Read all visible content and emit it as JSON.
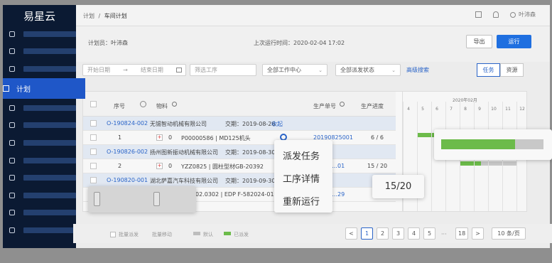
{
  "app": {
    "logo": "易星云"
  },
  "sidebar": {
    "active_label": "计划"
  },
  "header": {
    "crumb_parent": "计划",
    "crumb_sep": "/",
    "crumb_current": "车间计划",
    "user": "叶沛森"
  },
  "info": {
    "planner": "计划员：叶沛森",
    "last_run": "上次运行时间：2020-02-04 17:02",
    "export_label": "导出",
    "run_label": "运行"
  },
  "filters": {
    "start_date": "开始日期",
    "arrow": "→",
    "end_date": "结束日期",
    "process_placeholder": "筛选工序",
    "work_center": "全部工作中心",
    "dispatch_status": "全部派发状态",
    "advanced": "高级搜索",
    "tab_task": "任务",
    "tab_resource": "资源"
  },
  "table": {
    "headers": {
      "seq": "序号",
      "material": "物料",
      "order": "生产单号",
      "progress": "生产进度"
    },
    "groups": [
      {
        "order": "O-190824-002",
        "customer": "无锡智动机械有限公司",
        "delivery": "交期：2019-08-26",
        "action": "收起"
      },
      {
        "order": "O-190826-002",
        "customer": "扬州图新振动机械有限公司",
        "delivery": "交期：2019-08-30"
      },
      {
        "order": "O-190820-001",
        "customer": "湖北萨嘉汽车科技有限公司",
        "delivery": "交期：2019-09-30"
      }
    ],
    "items": [
      {
        "seq": "1",
        "qty": "0",
        "material": "P00000586 | MD125机头",
        "order": "20190825001",
        "progress": "6 / 6"
      },
      {
        "seq": "2",
        "qty": "0",
        "material": "YZZ0825 | 圆柱型材GB-20392",
        "order": "…01",
        "progress": "15 / 20"
      },
      {
        "material": "…02.0302 | EDP F-582024-01…",
        "order": "…29"
      }
    ]
  },
  "gantt": {
    "month": "2020年02月",
    "days": [
      "4",
      "5",
      "6",
      "7",
      "8",
      "9",
      "10",
      "11",
      "12"
    ]
  },
  "context_menu": {
    "dispatch": "派发任务",
    "details": "工序详情",
    "rerun": "重新运行"
  },
  "tooltip": {
    "progress": "15/20"
  },
  "footer": {
    "batch_dispatch": "批量派发",
    "batch_move": "批量移动",
    "legend_default": "默认",
    "legend_dispatched": "已派发",
    "prev": "<",
    "pages": [
      "1",
      "2",
      "3",
      "4",
      "5"
    ],
    "ellipsis": "···",
    "last_page": "18",
    "next": ">",
    "page_size": "10 条/页"
  },
  "colors": {
    "accent": "#1f6fe0",
    "sidebar": "#0b1a33",
    "bar_done": "#6cbb4a",
    "bar_pending": "#c8c8c8"
  }
}
